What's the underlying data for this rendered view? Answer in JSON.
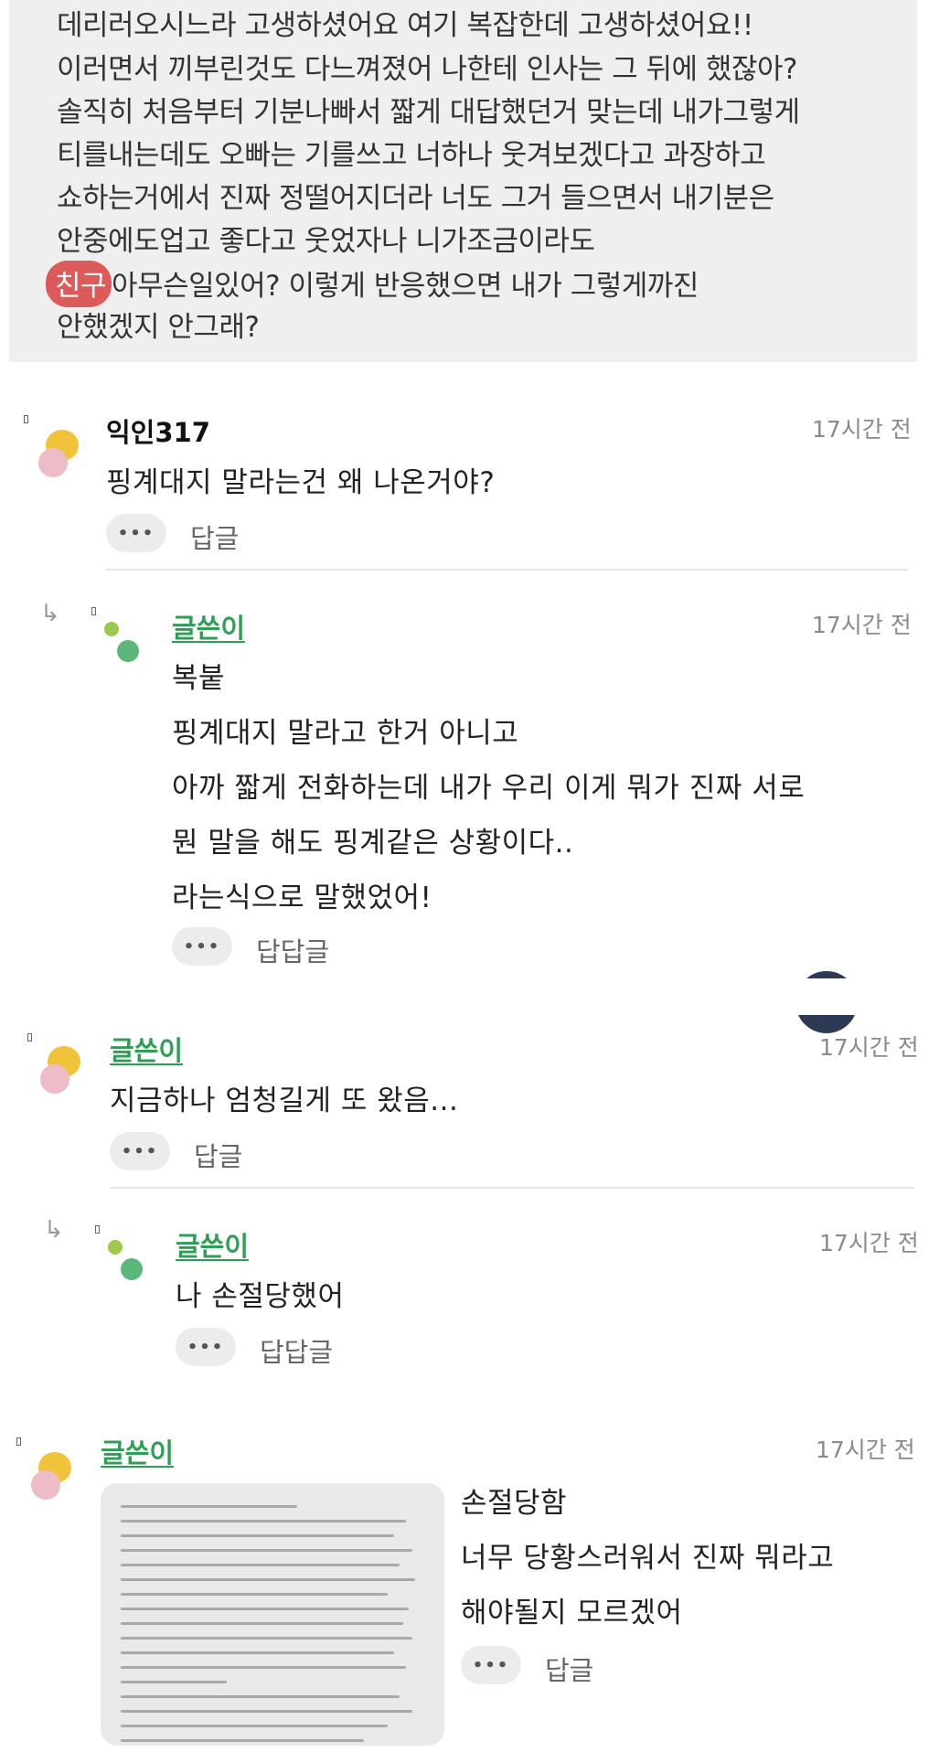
{
  "post_excerpt": {
    "lines": [
      "데리러오시느라 고생하셨어요 여기 복잡한데 고생하셨어요!!",
      "이러면서 끼부린것도 다느껴졌어 나한테 인사는 그 뒤에 했잖아?",
      "솔직히 처음부터 기분나빠서 짧게 대답했던거 맞는데 내가그렇게",
      "티를내는데도 오빠는 기를쓰고 너하나 웃겨보겠다고 과장하고",
      "쇼하는거에서 진짜 정떨어지더라 너도 그거 들으면서 내기분은",
      "안중에도업고 좋다고 웃었자나 니가조금이라도",
      "아무슨일있어? 이렇게 반응했으면 내가 그렇게까진",
      "안했겠지 안그래?"
    ],
    "badge": "친구"
  },
  "comments": [
    {
      "author": "익인317",
      "time": "17시간 전",
      "lines": [
        "핑계대지 말라는건 왜 나온거야?"
      ],
      "more": "•••",
      "reply_label": "답글"
    },
    {
      "author": "글쓴이",
      "time": "17시간 전",
      "lines": [
        "복붙",
        "핑계대지 말라고 한거 아니고",
        "아까 짧게 전화하는데 내가 우리 이게 뭐가 진짜 서로",
        "뭔 말을 해도 핑계같은 상황이다..",
        "라는식으로 말했었어!"
      ],
      "more": "•••",
      "reply_label": "답답글"
    },
    {
      "author": "글쓴이",
      "time": "17시간 전",
      "lines": [
        "지금하나 엄청길게 또 왔음..."
      ],
      "more": "•••",
      "reply_label": "답글"
    },
    {
      "author": "글쓴이",
      "time": "17시간 전",
      "lines": [
        "나 손절당했어"
      ],
      "more": "•••",
      "reply_label": "답답글"
    },
    {
      "author": "글쓴이",
      "time": "17시간 전",
      "lines": [
        "손절당함",
        "너무 당황스러워서 진짜 뭐라고",
        "해야될지 모르겠어"
      ],
      "more": "•••",
      "reply_label": "답글"
    }
  ],
  "colors": {
    "writer_name": "#2f9e55",
    "badge": "#dd5a5a",
    "quote_bg": "#efefef"
  },
  "icons": [
    "reply-arrow-icon",
    "more-icon",
    "avatar-icon"
  ]
}
